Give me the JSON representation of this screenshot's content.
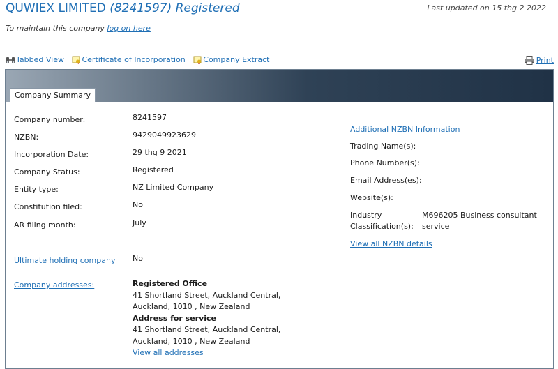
{
  "header": {
    "company_name": "QUWIEX LIMITED",
    "company_number_status": "(8241597) Registered",
    "last_updated": "Last updated on 15 thg 2 2022",
    "maintain_text": "To maintain this company",
    "logon_link": "log on here"
  },
  "toolbar": {
    "tabbed_view": "Tabbed View",
    "certificate": "Certificate of Incorporation",
    "extract": "Company Extract",
    "print": "Print"
  },
  "tab": {
    "label": "Company Summary"
  },
  "summary": {
    "rows": [
      {
        "label": "Company number:",
        "value": "8241597"
      },
      {
        "label": "NZBN:",
        "value": "9429049923629"
      },
      {
        "label": "Incorporation Date:",
        "value": "29 thg 9 2021"
      },
      {
        "label": "Company Status:",
        "value": "Registered"
      },
      {
        "label": "Entity type:",
        "value": "NZ Limited Company"
      },
      {
        "label": "Constitution filed:",
        "value": "No"
      },
      {
        "label": "AR filing month:",
        "value": "July"
      }
    ],
    "ultimate_holding_label": "Ultimate holding company",
    "ultimate_holding_value": "No",
    "addresses_label": "Company addresses:",
    "registered_office_heading": "Registered Office",
    "registered_office_line1": "41 Shortland Street, Auckland Central,",
    "registered_office_line2": "Auckland, 1010 , New Zealand",
    "service_heading": "Address for service",
    "service_line1": "41 Shortland Street, Auckland Central,",
    "service_line2": "Auckland, 1010 , New Zealand",
    "view_all_addresses": "View all addresses"
  },
  "nzbn": {
    "title": "Additional NZBN Information",
    "trading_name": "Trading Name(s):",
    "phone": "Phone Number(s):",
    "email": "Email Address(es):",
    "website": "Website(s):",
    "industry_label_1": "Industry",
    "industry_label_2": "Classification(s):",
    "industry_value": "M696205 Business consultant service",
    "view_details": "View all NZBN details"
  },
  "colors": {
    "link": "#1f6fb5",
    "header_dark": "#203246"
  }
}
